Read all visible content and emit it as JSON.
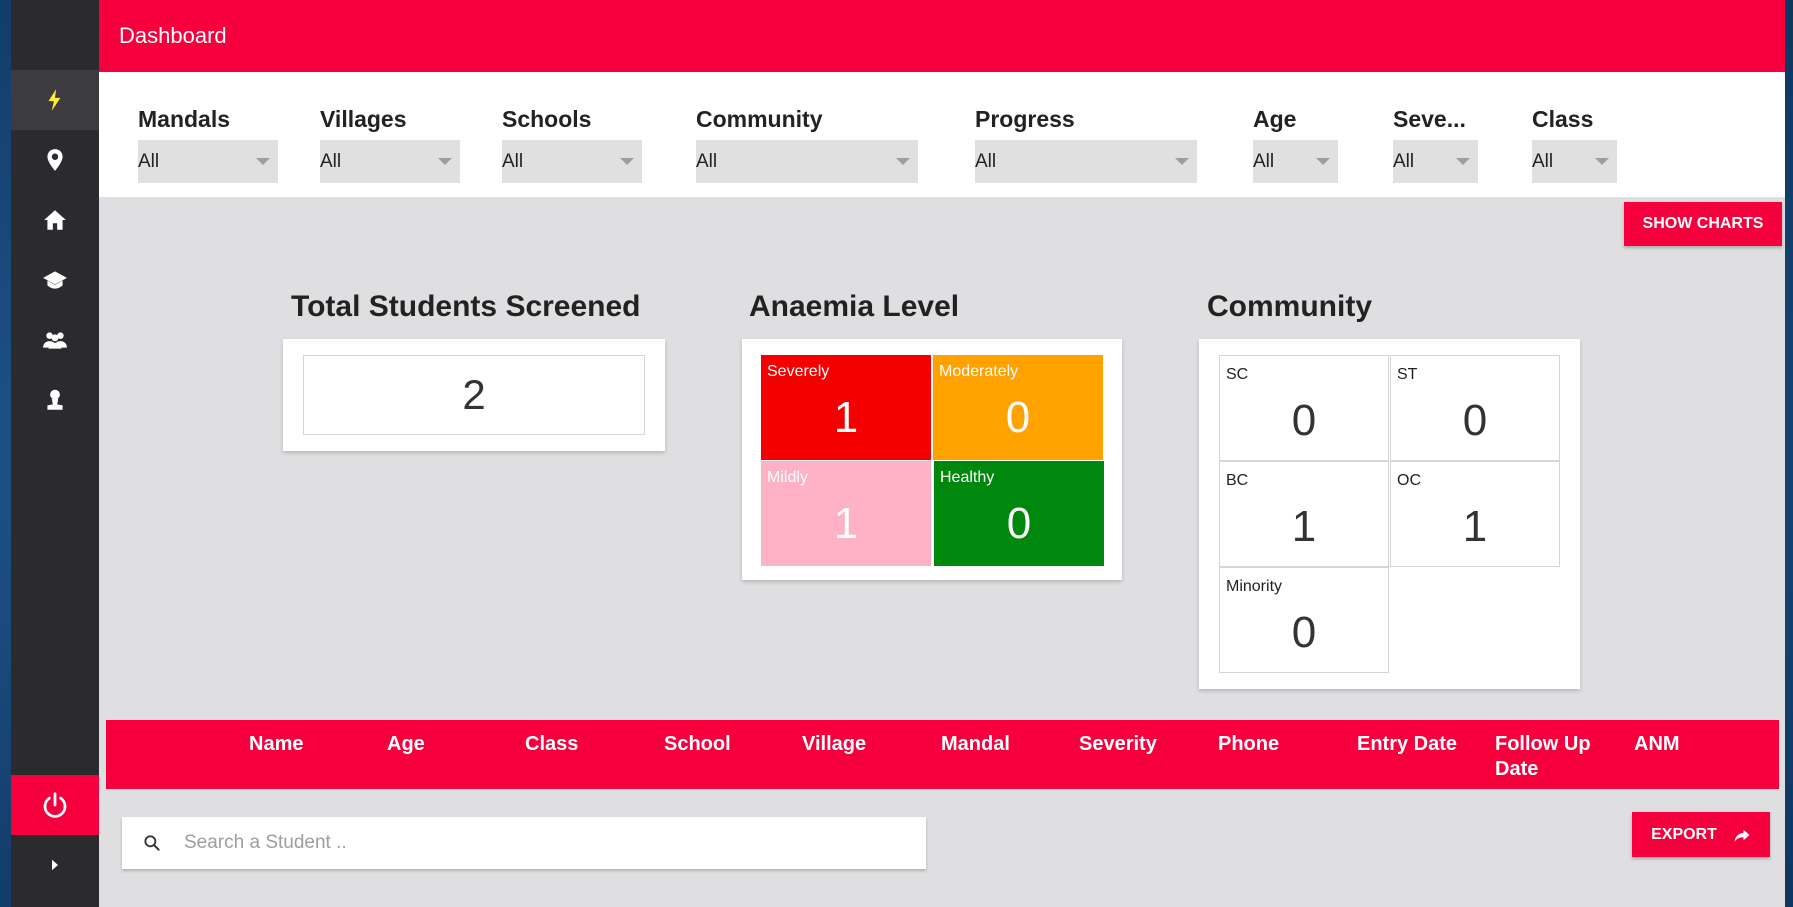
{
  "header": {
    "title": "Dashboard"
  },
  "sidebar": {
    "items": [
      {
        "icon": "flash-icon",
        "active": true
      },
      {
        "icon": "location-pin-icon"
      },
      {
        "icon": "home-icon"
      },
      {
        "icon": "graduation-cap-icon"
      },
      {
        "icon": "group-icon"
      },
      {
        "icon": "person-icon"
      }
    ],
    "power_icon": "power-icon",
    "expand_icon": "chevron-right-icon"
  },
  "filters": [
    {
      "label": "Mandals",
      "value": "All"
    },
    {
      "label": "Villages",
      "value": "All"
    },
    {
      "label": "Schools",
      "value": "All"
    },
    {
      "label": "Community",
      "value": "All"
    },
    {
      "label": "Progress",
      "value": "All"
    },
    {
      "label": "Age",
      "value": "All"
    },
    {
      "label": "Seve...",
      "value": "All"
    },
    {
      "label": "Class",
      "value": "All"
    }
  ],
  "show_charts_label": "SHOW CHARTS",
  "total": {
    "title": "Total Students Screened",
    "value": "2"
  },
  "anaemia": {
    "title": "Anaemia Level",
    "cells": [
      {
        "label": "Severely",
        "value": "1",
        "color": "#f50000"
      },
      {
        "label": "Moderately",
        "value": "0",
        "color": "#ffa200"
      },
      {
        "label": "Mildly",
        "value": "1",
        "color": "#ffb1c6"
      },
      {
        "label": "Healthy",
        "value": "0",
        "color": "#00870e"
      }
    ]
  },
  "community": {
    "title": "Community",
    "cells": [
      {
        "label": "SC",
        "value": "0"
      },
      {
        "label": "ST",
        "value": "0"
      },
      {
        "label": "BC",
        "value": "1"
      },
      {
        "label": "OC",
        "value": "1"
      },
      {
        "label": "Minority",
        "value": "0"
      }
    ]
  },
  "table": {
    "headers": [
      "Name",
      "Age",
      "Class",
      "School",
      "Village",
      "Mandal",
      "Severity",
      "Phone",
      "Entry Date",
      "Follow Up Date",
      "ANM"
    ]
  },
  "search": {
    "placeholder": "Search a Student .."
  },
  "export_label": "EXPORT",
  "colors": {
    "accent": "#f5003c",
    "sidebar": "#2b2b2f",
    "background": "#dfdfe1"
  }
}
